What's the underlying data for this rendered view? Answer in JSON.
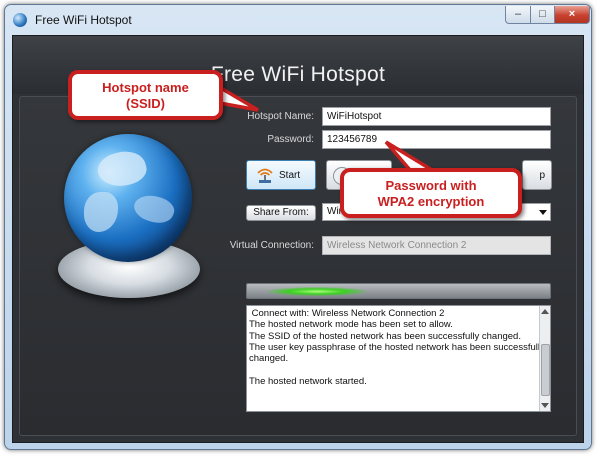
{
  "window": {
    "title": "Free WiFi Hotspot",
    "controls": {
      "minimize": "–",
      "maximize": "□",
      "close": "×"
    }
  },
  "header": {
    "title": "Free WiFi Hotspot"
  },
  "form": {
    "hotspot_name_label": "Hotspot Name:",
    "hotspot_name_value": "WiFiHotspot",
    "password_label": "Password:",
    "password_value": "123456789",
    "start_label": "Start",
    "partial_button_label": "p",
    "share_from_label": "Share From:",
    "share_from_value": "Wire",
    "virtual_connection_label": "Virtual Connection:",
    "virtual_connection_value": "Wireless Network Connection 2"
  },
  "log": {
    "lines": [
      " Connect with: Wireless Network Connection 2",
      "The hosted network mode has been set to allow.",
      "The SSID of the hosted network has been successfully changed.",
      "The user key passphrase of the hosted network has been successfully",
      "changed.",
      "",
      "The hosted network started."
    ]
  },
  "callouts": {
    "ssid_line1": "Hotspot name",
    "ssid_line2": "(SSID)",
    "password_line1": "Password with",
    "password_line2": "WPA2 encryption"
  },
  "icons": [
    "app-globe-icon",
    "globe-icon",
    "wifi-icon",
    "dropdown-arrow-icon"
  ],
  "colors": {
    "callout_red": "#c91f1f",
    "progress_glow": "#3ccf23",
    "panel_dark": "#2e3135"
  }
}
